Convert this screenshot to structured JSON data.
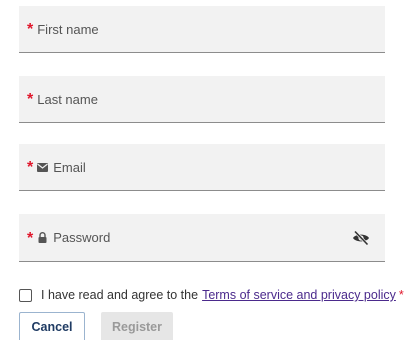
{
  "form": {
    "fields": [
      {
        "label": "First name",
        "required_mark": "*"
      },
      {
        "label": "Last name",
        "required_mark": "*"
      },
      {
        "label": "Email",
        "required_mark": "*",
        "icon": "envelope-icon"
      },
      {
        "label": "Password",
        "required_mark": "*",
        "icon": "lock-icon",
        "trailing_icon": "eye-slash-icon"
      }
    ],
    "agreement": {
      "text": "I have read and agree to the",
      "link": "Terms of service and privacy policy",
      "required_mark": "*",
      "checked": false
    },
    "buttons": {
      "cancel": "Cancel",
      "register": "Register"
    }
  },
  "colors": {
    "required": "#e0162b",
    "field_bg": "#f2f2f2",
    "link": "#4b2a8c",
    "cancel_text": "#1f3b63",
    "disabled_bg": "#e6e6e6"
  }
}
